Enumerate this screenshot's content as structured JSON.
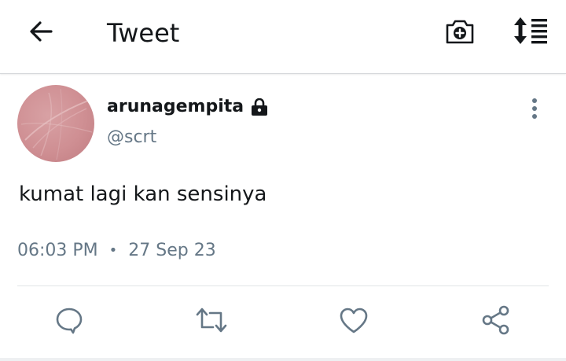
{
  "header": {
    "title": "Tweet",
    "back_icon": "arrow-left-icon",
    "camera_icon": "camera-add-icon",
    "sort_icon": "sort-list-icon"
  },
  "tweet": {
    "display_name": "arunagempita",
    "handle": "@scrt",
    "protected_icon": "lock-icon",
    "text": "kumat lagi kan sensinya",
    "time": "06:03 PM",
    "separator": "•",
    "date": "27 Sep 23",
    "more_icon": "more-vertical-icon"
  },
  "actions": [
    {
      "icon": "reply-icon"
    },
    {
      "icon": "retweet-icon"
    },
    {
      "icon": "like-icon"
    },
    {
      "icon": "share-icon"
    }
  ],
  "colors": {
    "text_primary": "#14171a",
    "text_secondary": "#657786",
    "avatar_pink": "#cf8f93"
  }
}
